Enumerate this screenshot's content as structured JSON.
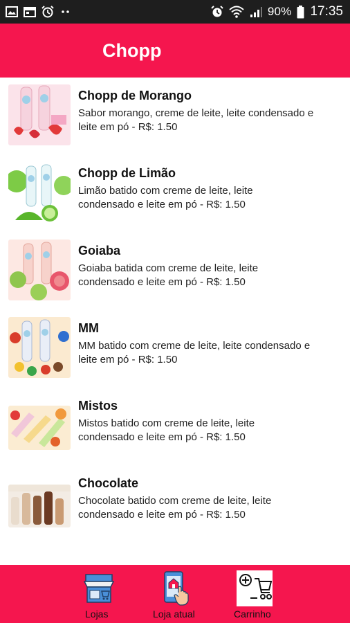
{
  "status_bar": {
    "battery_percent": "90%",
    "time": "17:35",
    "left_icons": [
      "image-icon",
      "calendar-icon",
      "alarm-icon",
      "dots-icon"
    ],
    "right_icons": [
      "alarm-icon",
      "wifi-icon",
      "signal-icon",
      "battery-icon"
    ]
  },
  "header": {
    "title": "Chopp"
  },
  "products": [
    {
      "name": "Chopp de Morango",
      "desc_line1": "Sabor morango, creme de leite, leite condensado e",
      "desc_line2": "leite em pó  - R$: 1.50",
      "image_icon": "strawberry-chopp-image",
      "colors": [
        "#f3b9c8",
        "#e23a3a"
      ]
    },
    {
      "name": "Chopp de Limão",
      "desc_line1": "Limão batido com creme de leite, leite",
      "desc_line2": "condensado e leite em pó  - R$: 1.50",
      "image_icon": "lime-chopp-image",
      "colors": [
        "#bfe6a8",
        "#4fb82f"
      ]
    },
    {
      "name": "Goiaba",
      "desc_line1": "Goiaba batida com creme de leite, leite",
      "desc_line2": "condensado e leite em pó  - R$: 1.50",
      "image_icon": "guava-chopp-image",
      "colors": [
        "#f7c3b2",
        "#e8566b"
      ]
    },
    {
      "name": "MM",
      "desc_line1": "MM batido com creme de leite, leite condensado e",
      "desc_line2": "leite em pó  - R$: 1.50",
      "image_icon": "candy-chopp-image",
      "colors": [
        "#f3d7a0",
        "#d93d2b"
      ]
    },
    {
      "name": "Mistos",
      "desc_line1": "Mistos batido com creme de leite, leite",
      "desc_line2": "condensado e leite em pó  - R$: 1.50",
      "image_icon": "mixed-chopp-image",
      "colors": [
        "#f4d6a6",
        "#e3622b"
      ]
    },
    {
      "name": "Chocolate",
      "desc_line1": "Chocolate batido com creme de leite, leite",
      "desc_line2": "condensado e leite em pó  - R$: 1.50",
      "image_icon": "chocolate-chopp-image",
      "colors": [
        "#e9d9c8",
        "#6b3a22"
      ]
    }
  ],
  "bottom_nav": [
    {
      "label": "Lojas",
      "icon": "store-icon"
    },
    {
      "label": "Loja atual",
      "icon": "phone-store-icon"
    },
    {
      "label": "Carrinho",
      "icon": "cart-icon"
    }
  ],
  "colors": {
    "brand": "#f5164e",
    "status_bar": "#1e1e1e",
    "text": "#111111"
  }
}
